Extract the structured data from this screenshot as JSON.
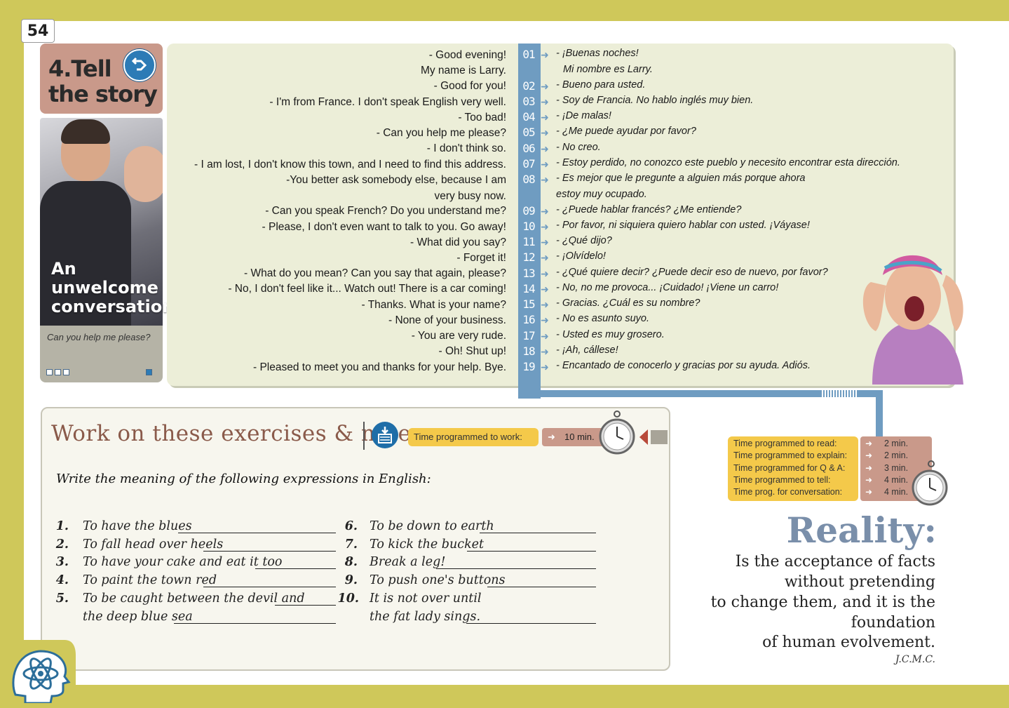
{
  "page_number": "54",
  "lesson": {
    "title": "4.Tell\nthe story",
    "photo_caption": "An\nunwelcome\nconversation",
    "subtitle": "Can you help me please?"
  },
  "dialogue": {
    "english": [
      "- Good evening!",
      "My name is Larry.",
      "- Good for you!",
      "- I'm from France. I don't speak English very well.",
      "- Too bad!",
      "- Can you help me please?",
      "- I don't think so.",
      "- I am lost, I don't know this town, and I need to find this address.",
      "-You better ask somebody else, because I am",
      "very busy now.",
      "- Can you speak French? Do you understand me?",
      "- Please, I don't even want to talk to you. Go away!",
      "- What did you say?",
      "- Forget it!",
      "- What do you mean? Can you say that again, please?",
      "- No, I don't feel like it... Watch out! There is a car coming!",
      "- Thanks. What is your name?",
      "- None of your business.",
      "- You are very rude.",
      "- Oh! Shut up!",
      "- Pleased to meet you and thanks for your help. Bye."
    ],
    "numbers": [
      "01",
      "02",
      "03",
      "04",
      "05",
      "06",
      "07",
      "08",
      "09",
      "10",
      "11",
      "12",
      "13",
      "14",
      "15",
      "16",
      "17",
      "18",
      "19"
    ],
    "spanish": [
      "- ¡Buenas noches!",
      "Mi nombre es Larry.",
      "-  Bueno para usted.",
      "- Soy de Francia. No hablo inglés muy bien.",
      "- ¡De malas!",
      "- ¿Me puede ayudar por favor?",
      "- No creo.",
      "- Estoy perdido, no conozco este pueblo y necesito encontrar esta dirección.",
      "- Es mejor que le pregunte a alguien más porque ahora",
      "estoy muy ocupado.",
      "- ¿Puede hablar francés? ¿Me entiende?",
      "- Por favor, ni siquiera quiero hablar con usted. ¡Váyase!",
      "- ¿Qué dijo?",
      "- ¡Olvídelo!",
      "- ¿Qué quiere decir? ¿Puede decir eso de nuevo, por favor?",
      "- No, no me provoca... ¡Cuidado!  ¡Viene un carro!",
      "- Gracias. ¿Cuál es su nombre?",
      "- No es asunto suyo.",
      "- Usted es muy grosero.",
      "- ¡Ah, cállese!",
      "- Encantado de conocerlo y gracias por su ayuda. Adiós."
    ]
  },
  "exercises": {
    "title": "Work on these exercises & notes",
    "time_label": "Time programmed to work:",
    "time_value": "10 min.",
    "instruction": "Write the meaning of the following expressions in English:",
    "items": [
      {
        "n": "1.",
        "text": "To have the blues"
      },
      {
        "n": "2.",
        "text": "To fall head over heels"
      },
      {
        "n": "3.",
        "text": "To have your cake and eat it too"
      },
      {
        "n": "4.",
        "text": "To paint the town red"
      },
      {
        "n": "5.",
        "text": "To be caught between the devil and",
        "text2": "the deep blue sea"
      },
      {
        "n": "6.",
        "text": "To be down to earth"
      },
      {
        "n": "7.",
        "text": "To kick the bucket"
      },
      {
        "n": "8.",
        "text": "Break a leg!"
      },
      {
        "n": "9.",
        "text": "To push one's buttons"
      },
      {
        "n": "10.",
        "text": "It is not over until",
        "text2": "the fat lady sings."
      }
    ]
  },
  "time_programmed": [
    {
      "label": "Time programmed to read:",
      "value": "2 min."
    },
    {
      "label": "Time programmed to explain:",
      "value": "2 min."
    },
    {
      "label": "Time programmed for Q & A:",
      "value": "3 min."
    },
    {
      "label": "Time programmed to tell:",
      "value": "4 min."
    },
    {
      "label": "Time prog. for conversation:",
      "value": "4 min."
    }
  ],
  "quote": {
    "heading": "Reality:",
    "lines": [
      "Is the acceptance of facts",
      "without pretending",
      "to change them, and it is the",
      "foundation",
      "of human evolvement."
    ],
    "author": "J.C.M.C."
  },
  "colors": {
    "olive_border": "#cfc85a",
    "dusty_rose": "#c9998a",
    "steel_blue": "#6f9cc1",
    "panel": "#eceed8",
    "yellow": "#f4c94a"
  }
}
